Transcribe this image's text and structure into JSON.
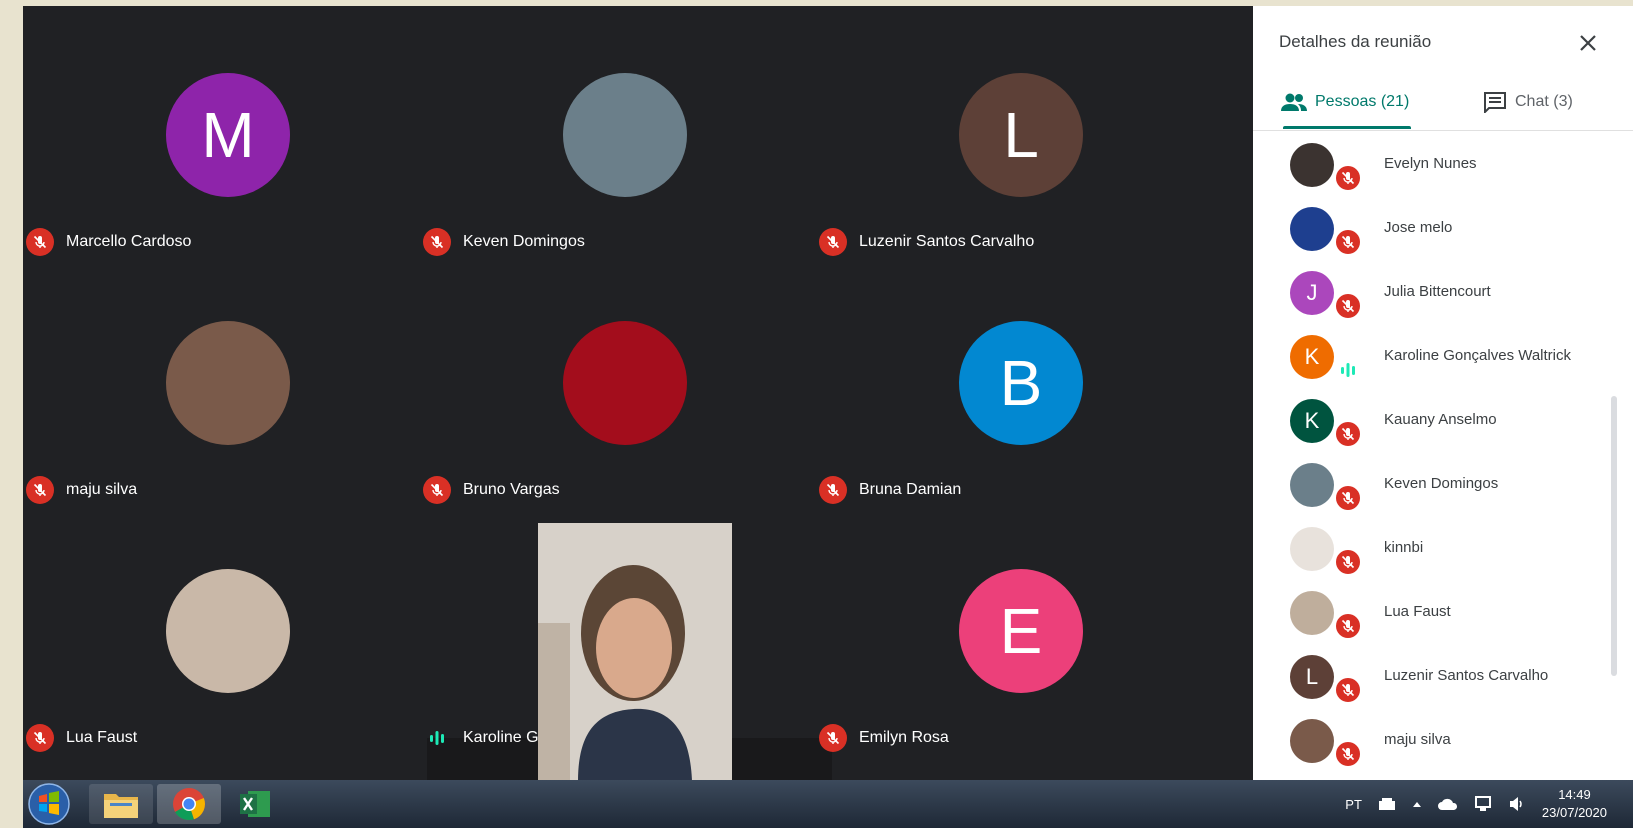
{
  "tiles": [
    {
      "name": "Marcello Cardoso",
      "initial": "M",
      "color": "#8e24aa",
      "status": "muted"
    },
    {
      "name": "Keven Domingos",
      "initial": "",
      "color": "#6b7f8a",
      "status": "muted"
    },
    {
      "name": "Luzenir Santos Carvalho",
      "initial": "L",
      "color": "#5d4037",
      "status": "muted"
    },
    {
      "name": "maju silva",
      "initial": "",
      "color": "#7a5a4a",
      "status": "muted"
    },
    {
      "name": "Bruno Vargas",
      "initial": "",
      "color": "#a30d1c",
      "status": "muted"
    },
    {
      "name": "Bruna Damian",
      "initial": "B",
      "color": "#0288d1",
      "status": "muted"
    },
    {
      "name": "Lua Faust",
      "initial": "",
      "color": "#c9b8a8",
      "status": "muted"
    },
    {
      "name": "Karoline Gonçalves Waltrick",
      "initial": "",
      "color": "#d9d4cc",
      "status": "speaking"
    },
    {
      "name": "Emilyn Rosa",
      "initial": "E",
      "color": "#ec407a",
      "status": "muted"
    }
  ],
  "panel": {
    "title": "Detalhes da reunião",
    "tabs": {
      "people": "Pessoas (21)",
      "chat": "Chat (3)"
    },
    "participants": [
      {
        "name": "Evelyn Nunes",
        "initial": "",
        "color": "#3b3330",
        "status": "muted"
      },
      {
        "name": "Jose melo",
        "initial": "",
        "color": "#1e3f8f",
        "status": "muted"
      },
      {
        "name": "Julia Bittencourt",
        "initial": "J",
        "color": "#ab47bc",
        "status": "muted"
      },
      {
        "name": "Karoline Gonçalves Waltrick",
        "initial": "K",
        "color": "#ef6c00",
        "status": "speaking"
      },
      {
        "name": "Kauany Anselmo",
        "initial": "K",
        "color": "#00543f",
        "status": "muted"
      },
      {
        "name": "Keven Domingos",
        "initial": "",
        "color": "#6b7f8a",
        "status": "muted"
      },
      {
        "name": "kinnbi",
        "initial": "",
        "color": "#e8e2dc",
        "status": "muted"
      },
      {
        "name": "Lua Faust",
        "initial": "",
        "color": "#bfae9c",
        "status": "muted"
      },
      {
        "name": "Luzenir Santos Carvalho",
        "initial": "L",
        "color": "#5d4037",
        "status": "muted"
      },
      {
        "name": "maju silva",
        "initial": "",
        "color": "#7a5a4a",
        "status": "muted"
      }
    ]
  },
  "taskbar": {
    "language": "PT",
    "time": "14:49",
    "date": "23/07/2020"
  }
}
